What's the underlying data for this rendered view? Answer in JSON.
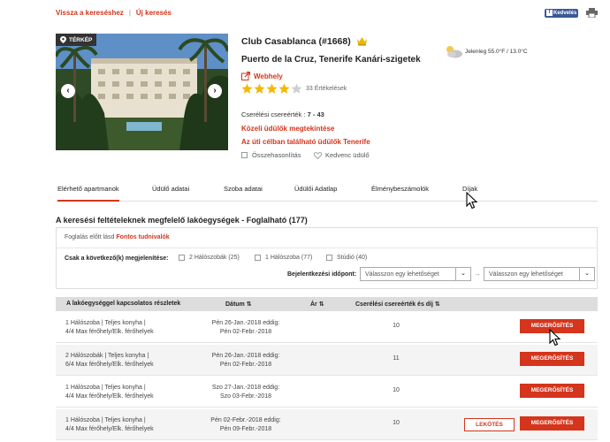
{
  "topnav": {
    "back": "Vissza a kereséshez",
    "new_search": "Új keresés"
  },
  "share": {
    "facebook": "Kedvelés"
  },
  "photo": {
    "map_badge": "TÉRKÉP"
  },
  "hotel": {
    "title": "Club Casablanca (#1668)",
    "location": "Puerto de la Cruz, Tenerife  Kanári-szigetek",
    "website": "Webhely",
    "rating": 4,
    "rating_max": 5,
    "reviews": "33 Értékelések",
    "exchange_label": "Cserélési csereérték :",
    "exchange_value": "7 - 43",
    "nearby": "Közeli üdülők megtekintése",
    "other_resorts": "Az úti célban található üdülők Tenerife",
    "compare": "Összehasonlítás",
    "favorite": "Kedvenc üdülő"
  },
  "weather": {
    "text": "Jelenleg 55.0°F / 13.0°C"
  },
  "tabs": [
    {
      "label": "Elérhető apartmanok",
      "active": true
    },
    {
      "label": "Üdülő adatai"
    },
    {
      "label": "Szoba adatai"
    },
    {
      "label": "Üdülői Adatlap"
    },
    {
      "label": "Élménybeszámolók"
    },
    {
      "label": "Díjak"
    }
  ],
  "section_title": "A keresési feltételeknek megfelelő lakóegységek - Foglalható (177)",
  "filter": {
    "note_prefix": "Foglalás előtt lásd",
    "note_link": "Fontos tudnivalók",
    "only_label": "Csak a következő(k) megjelenítése:",
    "options": [
      "2 Hálószobák (25)",
      "1 Hálószoba (77)",
      "Stúdió (40)"
    ],
    "checkin_label": "Bejelentkezési időpont:",
    "date_from_placeholder": "Válasszon egy lehetőséget",
    "date_to_placeholder": "Válasszon egy lehetőséget"
  },
  "table": {
    "headers": {
      "details": "A lakóegységgel kapcsolatos részletek",
      "date": "Dátum",
      "price": "Ár",
      "exchange": "Cserélési csereérték és díj"
    },
    "rows": [
      {
        "desc1": "1 Hálószoba | Teljes konyha |",
        "desc2": "4/4 Max férőhely/Elk. férőhelyek",
        "date1": "Pén 26-Jan.-2018 eddig:",
        "date2": "Pén 02-Febr.-2018",
        "value": "10",
        "book": ""
      },
      {
        "desc1": "2 Hálószobák | Teljes konyha |",
        "desc2": "6/4 Max férőhely/Elk. férőhelyek",
        "date1": "Pén 26-Jan.-2018 eddig:",
        "date2": "Pén 02-Febr.-2018",
        "value": "11",
        "book": ""
      },
      {
        "desc1": "1 Hálószoba | Teljes konyha |",
        "desc2": "4/4 Max férőhely/Elk. férőhelyek",
        "date1": "Szo 27-Jan.-2018 eddig:",
        "date2": "Szo 03-Febr.-2018",
        "value": "10",
        "book": ""
      },
      {
        "desc1": "1 Hálószoba | Teljes konyha |",
        "desc2": "4/4 Max férőhely/Elk. férőhelyek",
        "date1": "Pén 02-Febr.-2018 eddig:",
        "date2": "Pén 09-Febr.-2018",
        "value": "10",
        "book": "LEKÖTÉS"
      }
    ],
    "confirm_label": "MEGERŐSÍTÉS"
  },
  "colors": {
    "accent": "#d4351c",
    "header_bg": "#dddddd",
    "facebook": "#3b5998",
    "star": "#f5b800"
  }
}
